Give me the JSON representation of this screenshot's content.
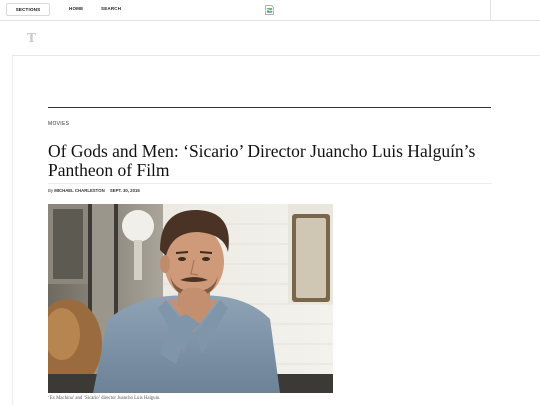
{
  "topbar": {
    "sections_label": "SECTIONS",
    "home_label": "HOME",
    "search_label": "SEARCH",
    "broken_image_icon": "broken-image-icon"
  },
  "masthead": {
    "logo_letter": "T"
  },
  "article": {
    "kicker": "MOVIES",
    "headline": "Of Gods and Men: ‘Sicario’ Director Juancho Luis Halguín’s Pantheon of Film",
    "byline_prefix": "By",
    "author": "MICHAEL CHARLESTON",
    "date": "SEPT. 30, 2015",
    "caption": "‘Ex Machina’ and ‘Sicario’ director Juancho Luis Halguín."
  },
  "colors": {
    "rule": "#333333",
    "text": "#111111",
    "divider": "#e2e2e2"
  }
}
